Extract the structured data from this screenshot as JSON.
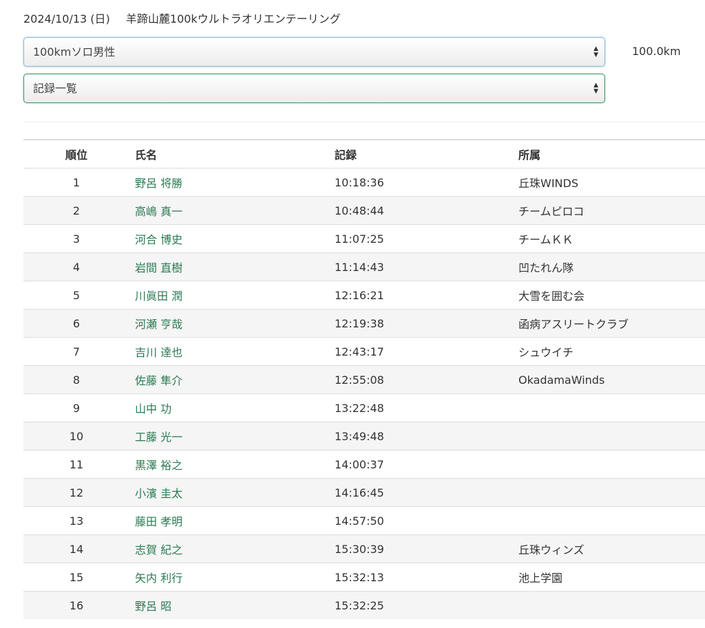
{
  "event": {
    "date": "2024/10/13 (日)",
    "name": "羊蹄山麓100kウルトラオリエンテーリング"
  },
  "selects": {
    "category": "100kmソロ男性",
    "view": "記録一覧"
  },
  "distance": "100.0km",
  "table": {
    "headers": [
      "順位",
      "氏名",
      "記録",
      "所属"
    ],
    "rows": [
      {
        "rank": "1",
        "name": "野呂 将勝",
        "time": "10:18:36",
        "club": "丘珠WINDS"
      },
      {
        "rank": "2",
        "name": "高嶋 真一",
        "time": "10:48:44",
        "club": "チームピロコ"
      },
      {
        "rank": "3",
        "name": "河合 博史",
        "time": "11:07:25",
        "club": "チームＫＫ"
      },
      {
        "rank": "4",
        "name": "岩間 直樹",
        "time": "11:14:43",
        "club": "凹たれん隊"
      },
      {
        "rank": "5",
        "name": "川眞田 潤",
        "time": "12:16:21",
        "club": "大雪を囲む会"
      },
      {
        "rank": "6",
        "name": "河瀬 亨哉",
        "time": "12:19:38",
        "club": "函病アスリートクラブ"
      },
      {
        "rank": "7",
        "name": "吉川 達也",
        "time": "12:43:17",
        "club": "シュウイチ"
      },
      {
        "rank": "8",
        "name": "佐藤 隼介",
        "time": "12:55:08",
        "club": "OkadamaWinds"
      },
      {
        "rank": "9",
        "name": "山中 功",
        "time": "13:22:48",
        "club": ""
      },
      {
        "rank": "10",
        "name": "工藤 光一",
        "time": "13:49:48",
        "club": ""
      },
      {
        "rank": "11",
        "name": "黒澤 裕之",
        "time": "14:00:37",
        "club": ""
      },
      {
        "rank": "12",
        "name": "小濱 圭太",
        "time": "14:16:45",
        "club": ""
      },
      {
        "rank": "13",
        "name": "藤田 孝明",
        "time": "14:57:50",
        "club": ""
      },
      {
        "rank": "14",
        "name": "志賀 紀之",
        "time": "15:30:39",
        "club": "丘珠ウィンズ"
      },
      {
        "rank": "15",
        "name": "矢内 利行",
        "time": "15:32:13",
        "club": "池上学園"
      },
      {
        "rank": "16",
        "name": "野呂 昭",
        "time": "15:32:25",
        "club": ""
      }
    ]
  },
  "colors": {
    "link": "#2a7a52",
    "row_stripe": "#f5f5f5",
    "select1_border": "#89b6d8",
    "select2_border": "#2c8a5a"
  }
}
